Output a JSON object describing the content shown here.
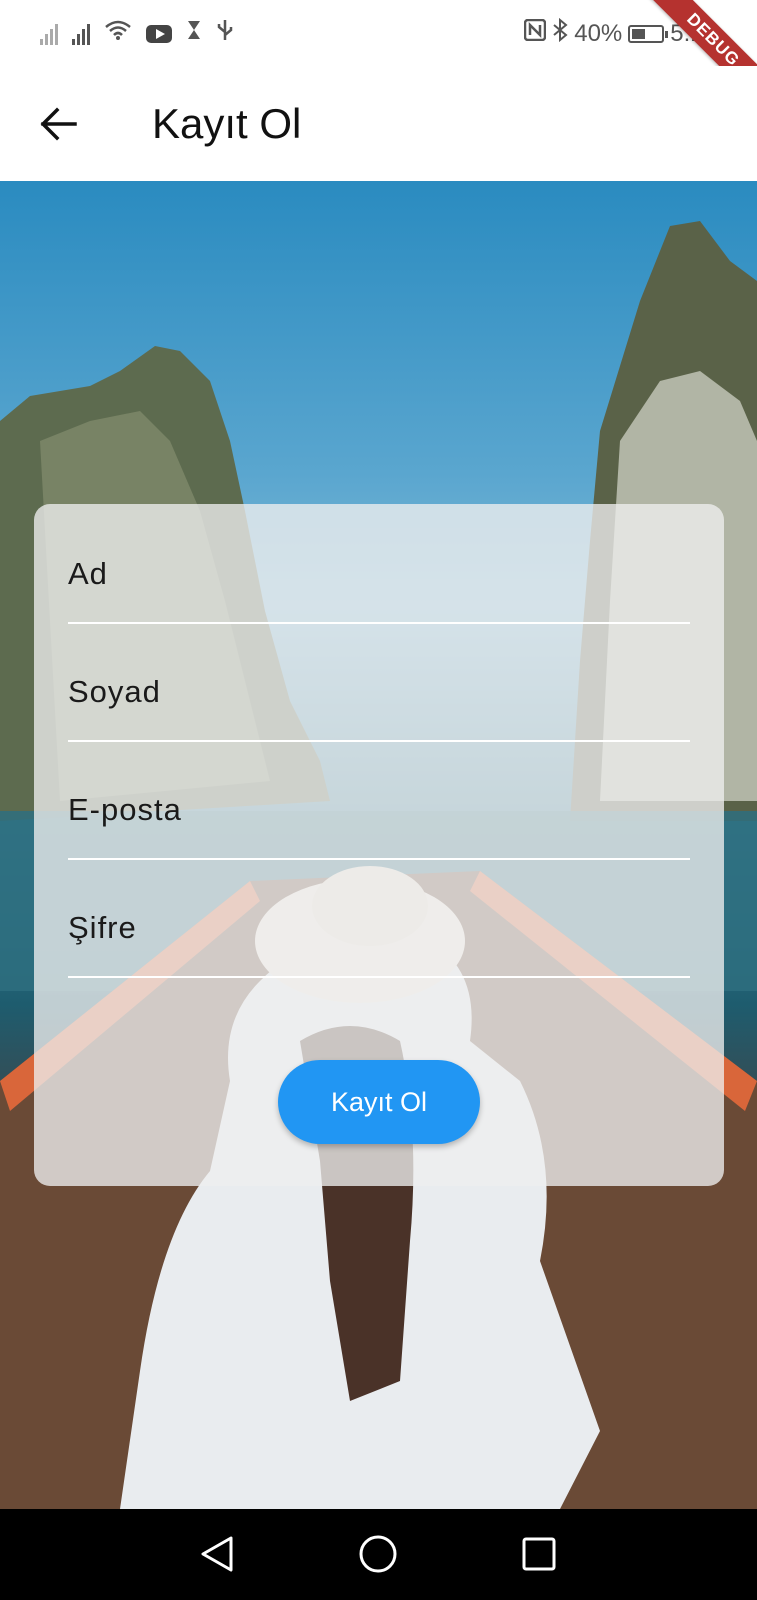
{
  "status_bar": {
    "battery": "40%",
    "time": "5:14",
    "debug_label": "DEBUG"
  },
  "app_bar": {
    "title": "Kayıt Ol",
    "back_icon": "arrow-left-icon"
  },
  "form": {
    "fields": [
      {
        "name": "ad",
        "placeholder": "Ad",
        "value": ""
      },
      {
        "name": "soyad",
        "placeholder": "Soyad",
        "value": ""
      },
      {
        "name": "eposta",
        "placeholder": "E-posta",
        "value": ""
      },
      {
        "name": "sifre",
        "placeholder": "Şifre",
        "value": ""
      }
    ],
    "submit_label": "Kayıt Ol"
  },
  "colors": {
    "accent": "#2196f3",
    "debug_ribbon": "#b5322f"
  },
  "nav_bar": {
    "back_icon": "triangle-back-icon",
    "home_icon": "circle-home-icon",
    "recents_icon": "square-recents-icon"
  }
}
